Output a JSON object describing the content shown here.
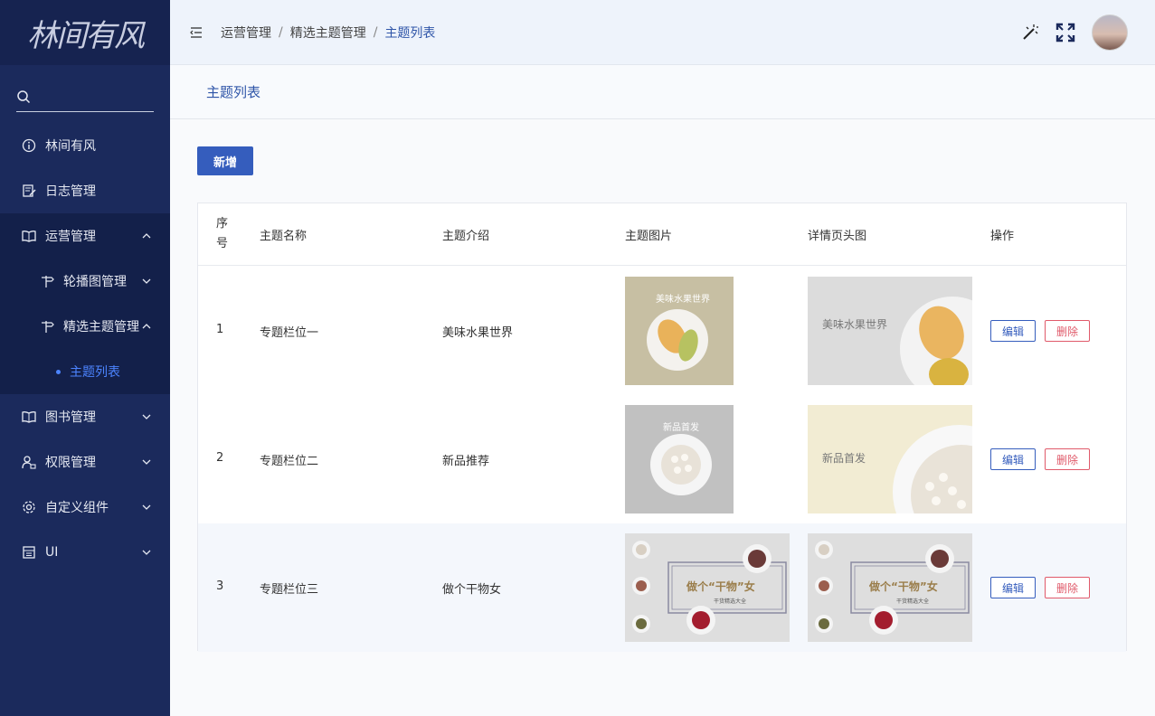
{
  "logo": {
    "text": "林间有风"
  },
  "sidebar": {
    "items": [
      {
        "label": "林间有风"
      },
      {
        "label": "日志管理"
      },
      {
        "label": "运营管理"
      },
      {
        "label": "轮播图管理"
      },
      {
        "label": "精选主题管理"
      },
      {
        "label": "主题列表"
      },
      {
        "label": "图书管理"
      },
      {
        "label": "权限管理"
      },
      {
        "label": "自定义组件"
      },
      {
        "label": "UI"
      }
    ]
  },
  "breadcrumb": {
    "items": [
      "运营管理",
      "精选主题管理",
      "主题列表"
    ],
    "sep": "/"
  },
  "page": {
    "title": "主题列表",
    "add_label": "新增"
  },
  "table": {
    "columns": [
      "序号",
      "主题名称",
      "主题介绍",
      "主题图片",
      "详情页头图",
      "操作"
    ],
    "rows": [
      {
        "idx": "1",
        "name": "专题栏位一",
        "intro": "美味水果世界",
        "img_text": "美味水果世界",
        "banner_text": "美味水果世界"
      },
      {
        "idx": "2",
        "name": "专题栏位二",
        "intro": "新品推荐",
        "img_text": "新品首发",
        "banner_text": "新品首发"
      },
      {
        "idx": "3",
        "name": "专题栏位三",
        "intro": "做个干物女",
        "img_text": "做个“干物”女",
        "banner_text": "做个“干物”女",
        "img_sub": "干货精选大全"
      }
    ],
    "edit_label": "编辑",
    "delete_label": "删除"
  },
  "colors": {
    "sidebar": "#1b2a5c",
    "accent": "#355dbd",
    "danger": "#e05a6a"
  }
}
